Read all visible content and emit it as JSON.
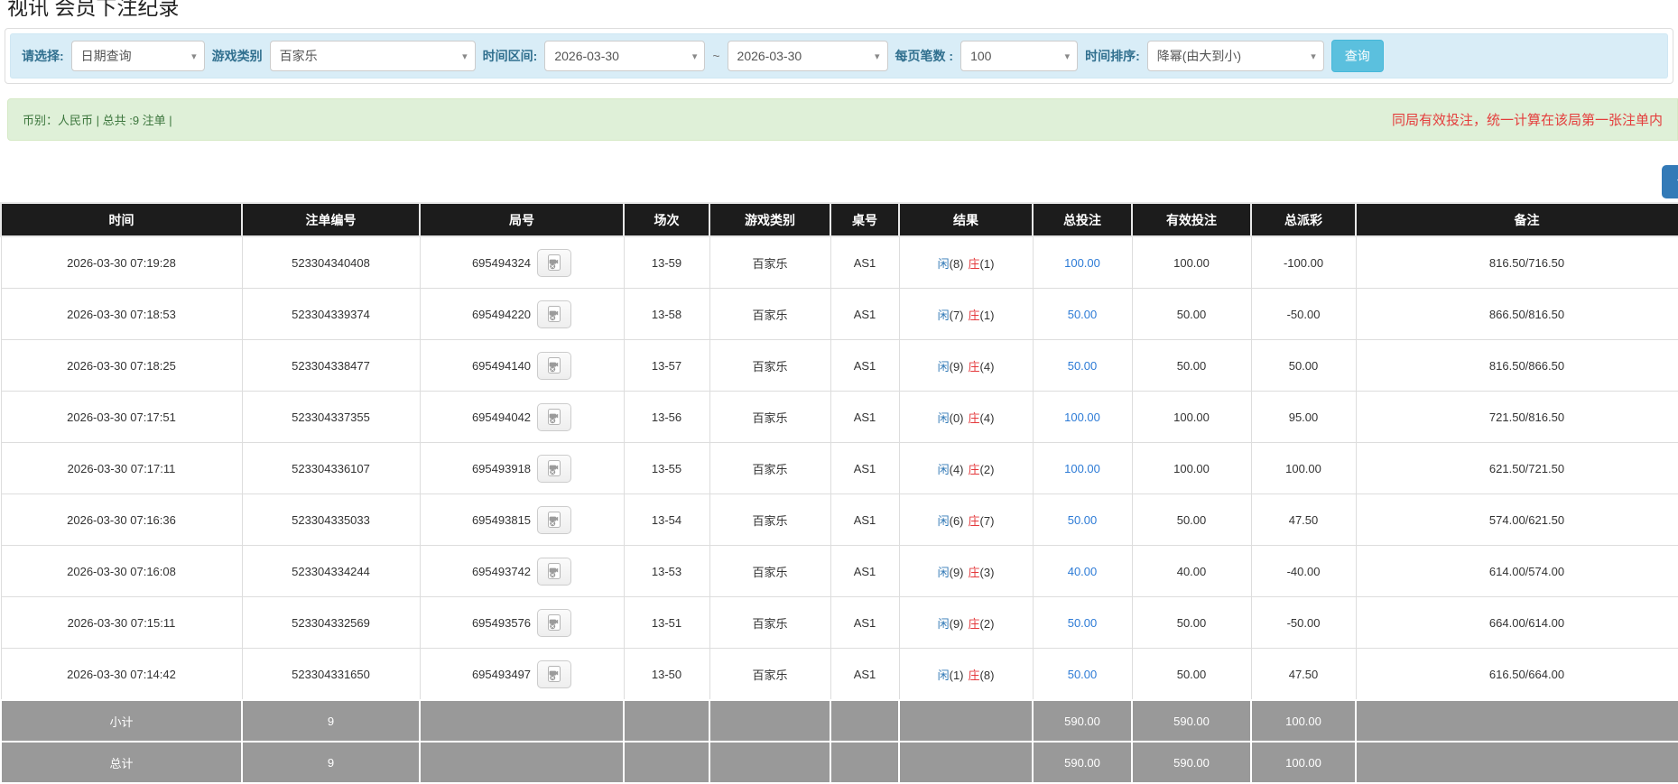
{
  "page": {
    "title": "视讯 会员下注纪录"
  },
  "filters": {
    "select_label": "请选择:",
    "select_value": "日期查询",
    "game_type_label": "游戏类别",
    "game_type_value": "百家乐",
    "time_range_label": "时间区间:",
    "date_from": "2026-03-30",
    "tilde": "~",
    "date_to": "2026-03-30",
    "page_size_label": "每页笔数 :",
    "page_size_value": "100",
    "sort_label": "时间排序:",
    "sort_value": "降幂(由大到小)",
    "search_button": "查询"
  },
  "summary": {
    "left_text": "币别：人民币 | 总共 :9 注单 |",
    "right_notice": "同局有效投注，统一计算在该局第一张注单内"
  },
  "top_button": {
    "icon": "↑"
  },
  "table": {
    "headers": [
      "时间",
      "注单编号",
      "局号",
      "场次",
      "游戏类别",
      "桌号",
      "结果",
      "总投注",
      "有效投注",
      "总派彩",
      "备注"
    ],
    "rows": [
      {
        "time": "2026-03-30 07:19:28",
        "bet_id": "523304340408",
        "round_id": "695494324",
        "session": "13-59",
        "game_type": "百家乐",
        "table_no": "AS1",
        "result_player": "闲",
        "result_player_score": "(8)",
        "result_banker": "庄",
        "result_banker_score": "(1)",
        "total_bet": "100.00",
        "valid_bet": "100.00",
        "payout": "-100.00",
        "remark": "816.50/716.50"
      },
      {
        "time": "2026-03-30 07:18:53",
        "bet_id": "523304339374",
        "round_id": "695494220",
        "session": "13-58",
        "game_type": "百家乐",
        "table_no": "AS1",
        "result_player": "闲",
        "result_player_score": "(7)",
        "result_banker": "庄",
        "result_banker_score": "(1)",
        "total_bet": "50.00",
        "valid_bet": "50.00",
        "payout": "-50.00",
        "remark": "866.50/816.50"
      },
      {
        "time": "2026-03-30 07:18:25",
        "bet_id": "523304338477",
        "round_id": "695494140",
        "session": "13-57",
        "game_type": "百家乐",
        "table_no": "AS1",
        "result_player": "闲",
        "result_player_score": "(9)",
        "result_banker": "庄",
        "result_banker_score": "(4)",
        "total_bet": "50.00",
        "valid_bet": "50.00",
        "payout": "50.00",
        "remark": "816.50/866.50"
      },
      {
        "time": "2026-03-30 07:17:51",
        "bet_id": "523304337355",
        "round_id": "695494042",
        "session": "13-56",
        "game_type": "百家乐",
        "table_no": "AS1",
        "result_player": "闲",
        "result_player_score": "(0)",
        "result_banker": "庄",
        "result_banker_score": "(4)",
        "total_bet": "100.00",
        "valid_bet": "100.00",
        "payout": "95.00",
        "remark": "721.50/816.50"
      },
      {
        "time": "2026-03-30 07:17:11",
        "bet_id": "523304336107",
        "round_id": "695493918",
        "session": "13-55",
        "game_type": "百家乐",
        "table_no": "AS1",
        "result_player": "闲",
        "result_player_score": "(4)",
        "result_banker": "庄",
        "result_banker_score": "(2)",
        "total_bet": "100.00",
        "valid_bet": "100.00",
        "payout": "100.00",
        "remark": "621.50/721.50"
      },
      {
        "time": "2026-03-30 07:16:36",
        "bet_id": "523304335033",
        "round_id": "695493815",
        "session": "13-54",
        "game_type": "百家乐",
        "table_no": "AS1",
        "result_player": "闲",
        "result_player_score": "(6)",
        "result_banker": "庄",
        "result_banker_score": "(7)",
        "total_bet": "50.00",
        "valid_bet": "50.00",
        "payout": "47.50",
        "remark": "574.00/621.50"
      },
      {
        "time": "2026-03-30 07:16:08",
        "bet_id": "523304334244",
        "round_id": "695493742",
        "session": "13-53",
        "game_type": "百家乐",
        "table_no": "AS1",
        "result_player": "闲",
        "result_player_score": "(9)",
        "result_banker": "庄",
        "result_banker_score": "(3)",
        "total_bet": "40.00",
        "valid_bet": "40.00",
        "payout": "-40.00",
        "remark": "614.00/574.00"
      },
      {
        "time": "2026-03-30 07:15:11",
        "bet_id": "523304332569",
        "round_id": "695493576",
        "session": "13-51",
        "game_type": "百家乐",
        "table_no": "AS1",
        "result_player": "闲",
        "result_player_score": "(9)",
        "result_banker": "庄",
        "result_banker_score": "(2)",
        "total_bet": "50.00",
        "valid_bet": "50.00",
        "payout": "-50.00",
        "remark": "664.00/614.00"
      },
      {
        "time": "2026-03-30 07:14:42",
        "bet_id": "523304331650",
        "round_id": "695493497",
        "session": "13-50",
        "game_type": "百家乐",
        "table_no": "AS1",
        "result_player": "闲",
        "result_player_score": "(1)",
        "result_banker": "庄",
        "result_banker_score": "(8)",
        "total_bet": "50.00",
        "valid_bet": "50.00",
        "payout": "47.50",
        "remark": "616.50/664.00"
      }
    ],
    "subtotal": {
      "label": "小计",
      "count": "9",
      "total_bet": "590.00",
      "valid_bet": "590.00",
      "payout": "100.00"
    },
    "total": {
      "label": "总计",
      "count": "9",
      "total_bet": "590.00",
      "valid_bet": "590.00",
      "payout": "100.00"
    }
  },
  "icons": {
    "chevron_down": "▾",
    "up_arrow": "↑",
    "video_replay": "video-file-icon"
  },
  "colors": {
    "filter_bar_bg": "#d9edf7",
    "filter_label": "#31708f",
    "search_button_bg": "#5bc0de",
    "summary_bg": "#dff0d8",
    "summary_text": "#3c763d",
    "notice_red": "#e43d3c",
    "header_bg": "#1c1c1c",
    "link_blue": "#2d7bd6",
    "player_blue": "#337ab7",
    "banker_red": "#e4393c",
    "footer_gray": "#999999",
    "top_button_blue": "#337ab7"
  }
}
